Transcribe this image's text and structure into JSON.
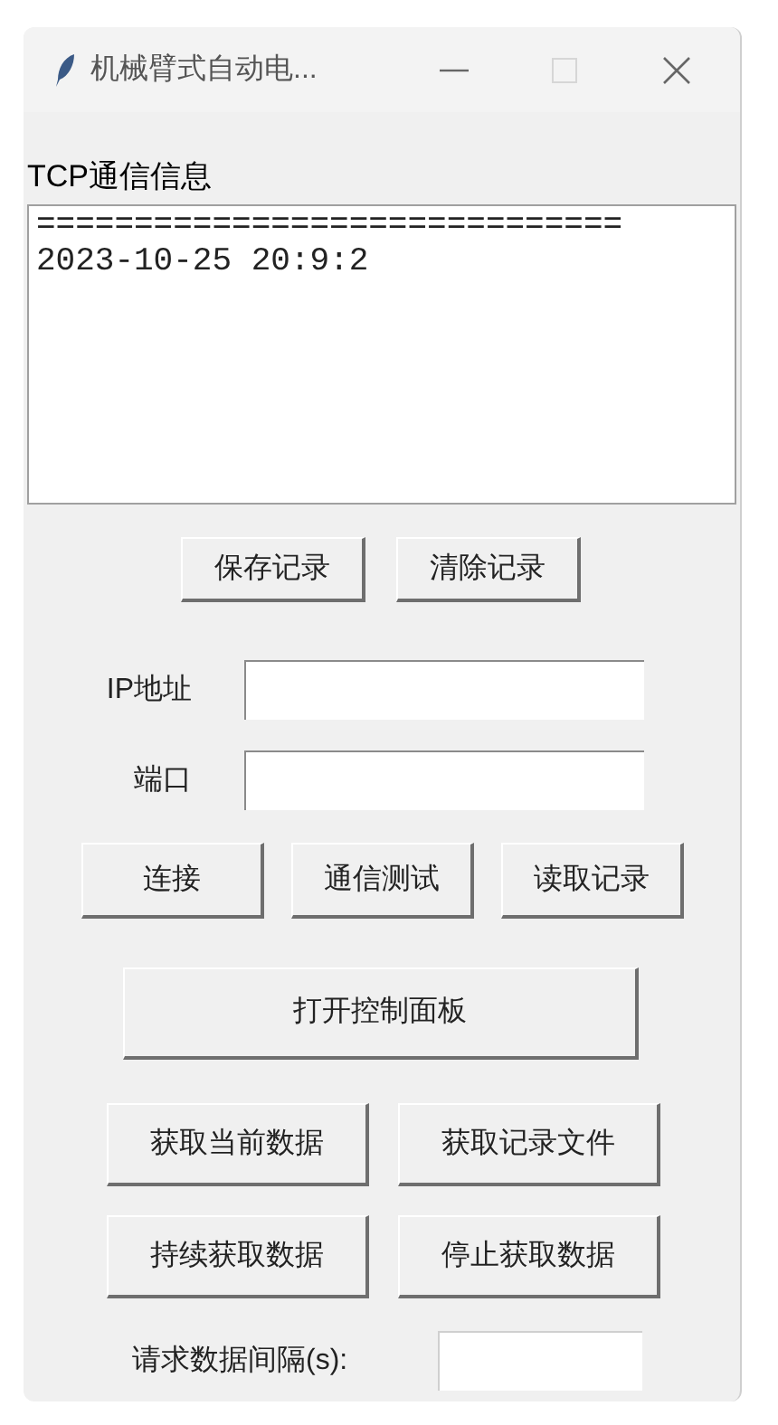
{
  "window": {
    "title": "机械臂式自动电...",
    "maximize_disabled": true
  },
  "log": {
    "label": "TCP通信信息",
    "lines": [
      "==============================",
      "2023-10-25 20:9:2"
    ]
  },
  "record_buttons": [
    "保存记录",
    "清除记录"
  ],
  "fields": [
    {
      "label": "IP地址"
    },
    {
      "label": "端口"
    }
  ],
  "connection_buttons": [
    "连接",
    "通信测试",
    "读取记录"
  ],
  "panel_button": "打开控制面板",
  "data_buttons": [
    [
      "获取当前数据",
      "获取记录文件"
    ],
    [
      "持续获取数据",
      "停止获取数据"
    ]
  ],
  "interval": {
    "label": "请求数据间隔(s):"
  }
}
